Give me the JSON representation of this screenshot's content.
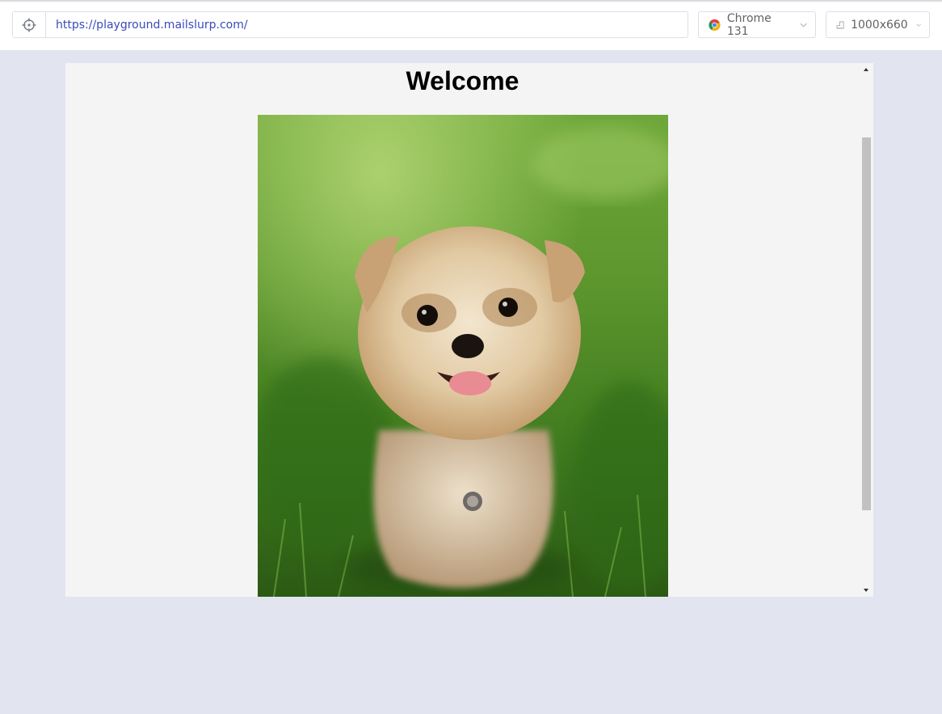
{
  "toolbar": {
    "url": "https://playground.mailslurp.com/",
    "browser_label": "Chrome 131",
    "size_label": "1000x660"
  },
  "page": {
    "title": "Welcome"
  },
  "colors": {
    "url_text": "#3a4bb8",
    "background": "#e2e5ef",
    "viewport": "#f4f4f4"
  },
  "icons": {
    "target": "crosshair-icon",
    "browser": "chrome-icon",
    "size": "ruler-icon",
    "chevron": "chevron-down-icon"
  }
}
